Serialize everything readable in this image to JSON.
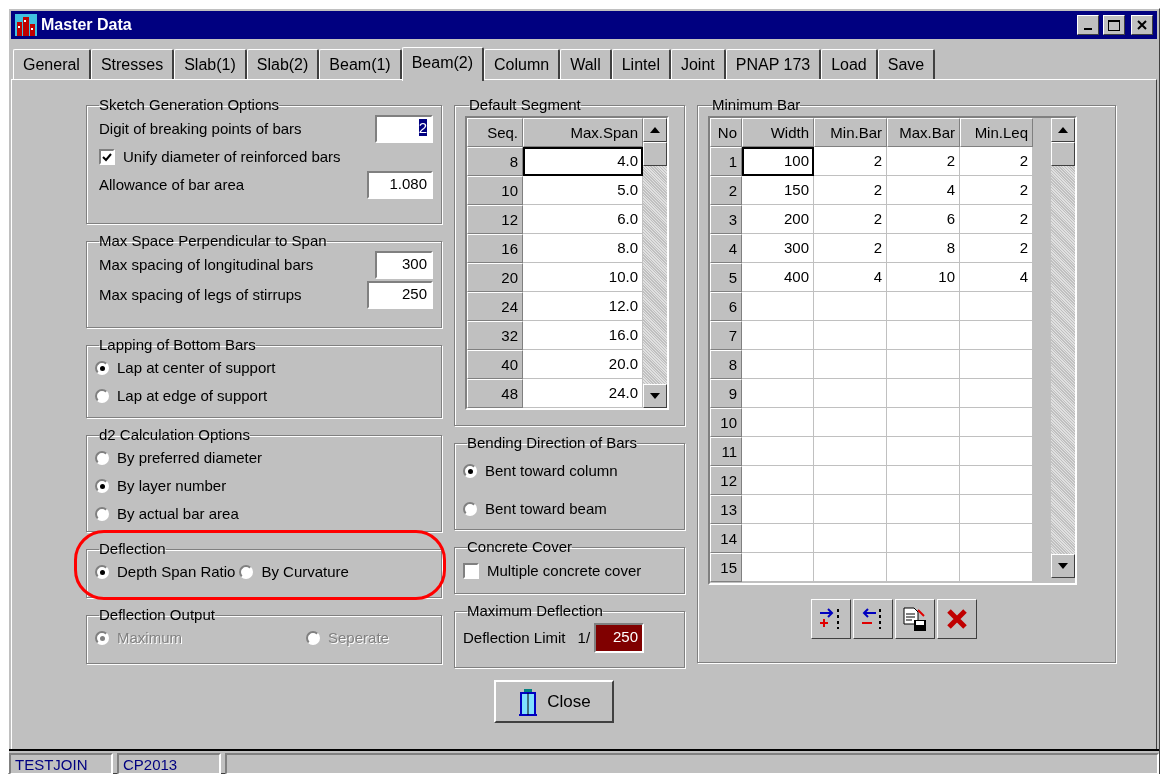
{
  "window": {
    "title": "Master Data"
  },
  "tabs": [
    {
      "label": "General",
      "selected": false
    },
    {
      "label": "Stresses",
      "selected": false
    },
    {
      "label": "Slab(1)",
      "selected": false
    },
    {
      "label": "Slab(2)",
      "selected": false
    },
    {
      "label": "Beam(1)",
      "selected": false
    },
    {
      "label": "Beam(2)",
      "selected": true
    },
    {
      "label": "Column",
      "selected": false
    },
    {
      "label": "Wall",
      "selected": false
    },
    {
      "label": "Lintel",
      "selected": false
    },
    {
      "label": "Joint",
      "selected": false
    },
    {
      "label": "PNAP 173",
      "selected": false
    },
    {
      "label": "Load",
      "selected": false
    },
    {
      "label": "Save",
      "selected": false
    }
  ],
  "sketch_generation": {
    "title": "Sketch Generation Options",
    "items": [
      {
        "kind": "field",
        "label": "Digit of breaking points of bars",
        "value": "2",
        "text_selected": true
      },
      {
        "kind": "checkbox",
        "label": "Unify diameter of reinforced bars",
        "checked": true
      },
      {
        "kind": "field",
        "label": "Allowance of bar area",
        "value": "1.080",
        "text_selected": false
      }
    ]
  },
  "max_space": {
    "title": "Max Space Perpendicular to Span",
    "items": [
      {
        "kind": "field",
        "label": "Max spacing of longitudinal bars",
        "value": "300",
        "text_selected": false
      },
      {
        "kind": "field",
        "label": "Max spacing of legs of stirrups",
        "value": "250",
        "text_selected": false
      }
    ]
  },
  "lapping": {
    "title": "Lapping of Bottom Bars",
    "options": [
      {
        "label": "Lap at center of support",
        "selected": true
      },
      {
        "label": "Lap at edge of support",
        "selected": false
      }
    ]
  },
  "d2_calculation": {
    "title": "d2 Calculation Options",
    "options": [
      {
        "label": "By preferred diameter",
        "selected": false
      },
      {
        "label": "By layer number",
        "selected": true
      },
      {
        "label": "By actual bar area",
        "selected": false
      }
    ]
  },
  "deflection": {
    "title": "Deflection",
    "highlighted": true,
    "options": [
      {
        "label": "Depth Span Ratio",
        "selected": true
      },
      {
        "label": "By Curvature",
        "selected": false
      }
    ]
  },
  "deflection_output": {
    "title": "Deflection Output",
    "disabled": true,
    "options": [
      {
        "label": "Maximum",
        "selected": true
      },
      {
        "label": "Seperate",
        "selected": false
      }
    ]
  },
  "default_segment": {
    "title": "Default Segment",
    "columns": [
      "Seq.",
      "Max.Span"
    ],
    "rows": [
      {
        "seq": "8",
        "max_span": "4.0",
        "selected": true
      },
      {
        "seq": "10",
        "max_span": "5.0",
        "selected": false
      },
      {
        "seq": "12",
        "max_span": "6.0",
        "selected": false
      },
      {
        "seq": "16",
        "max_span": "8.0",
        "selected": false
      },
      {
        "seq": "20",
        "max_span": "10.0",
        "selected": false
      },
      {
        "seq": "24",
        "max_span": "12.0",
        "selected": false
      },
      {
        "seq": "32",
        "max_span": "16.0",
        "selected": false
      },
      {
        "seq": "40",
        "max_span": "20.0",
        "selected": false
      },
      {
        "seq": "48",
        "max_span": "24.0",
        "selected": false
      }
    ]
  },
  "bending_direction": {
    "title": "Bending Direction of Bars",
    "options": [
      {
        "label": "Bent toward column",
        "selected": true
      },
      {
        "label": "Bent toward beam",
        "selected": false
      }
    ]
  },
  "concrete_cover": {
    "title": "Concrete Cover",
    "label": "Multiple concrete cover",
    "checked": false
  },
  "maximum_deflection": {
    "title": "Maximum Deflection",
    "label": "Deflection Limit",
    "prefix": "1/",
    "value": "250"
  },
  "minimum_bar": {
    "title": "Minimum Bar",
    "columns": [
      "No",
      "Width",
      "Min.Bar",
      "Max.Bar",
      "Min.Leq"
    ],
    "rows": [
      {
        "no": "1",
        "cells": [
          "100",
          "2",
          "2",
          "2"
        ],
        "selected": true
      },
      {
        "no": "2",
        "cells": [
          "150",
          "2",
          "4",
          "2"
        ],
        "selected": false
      },
      {
        "no": "3",
        "cells": [
          "200",
          "2",
          "6",
          "2"
        ],
        "selected": false
      },
      {
        "no": "4",
        "cells": [
          "300",
          "2",
          "8",
          "2"
        ],
        "selected": false
      },
      {
        "no": "5",
        "cells": [
          "400",
          "4",
          "10",
          "4"
        ],
        "selected": false
      },
      {
        "no": "6",
        "selected": false
      },
      {
        "no": "7",
        "selected": false
      },
      {
        "no": "8",
        "selected": false
      },
      {
        "no": "9",
        "selected": false
      },
      {
        "no": "10",
        "selected": false
      },
      {
        "no": "11",
        "selected": false
      },
      {
        "no": "12",
        "selected": false
      },
      {
        "no": "13",
        "selected": false
      },
      {
        "no": "14",
        "selected": false
      },
      {
        "no": "15",
        "selected": false
      }
    ]
  },
  "close_button": {
    "label": "Close"
  },
  "status_bar": [
    "TESTJOIN",
    "CP2013"
  ]
}
